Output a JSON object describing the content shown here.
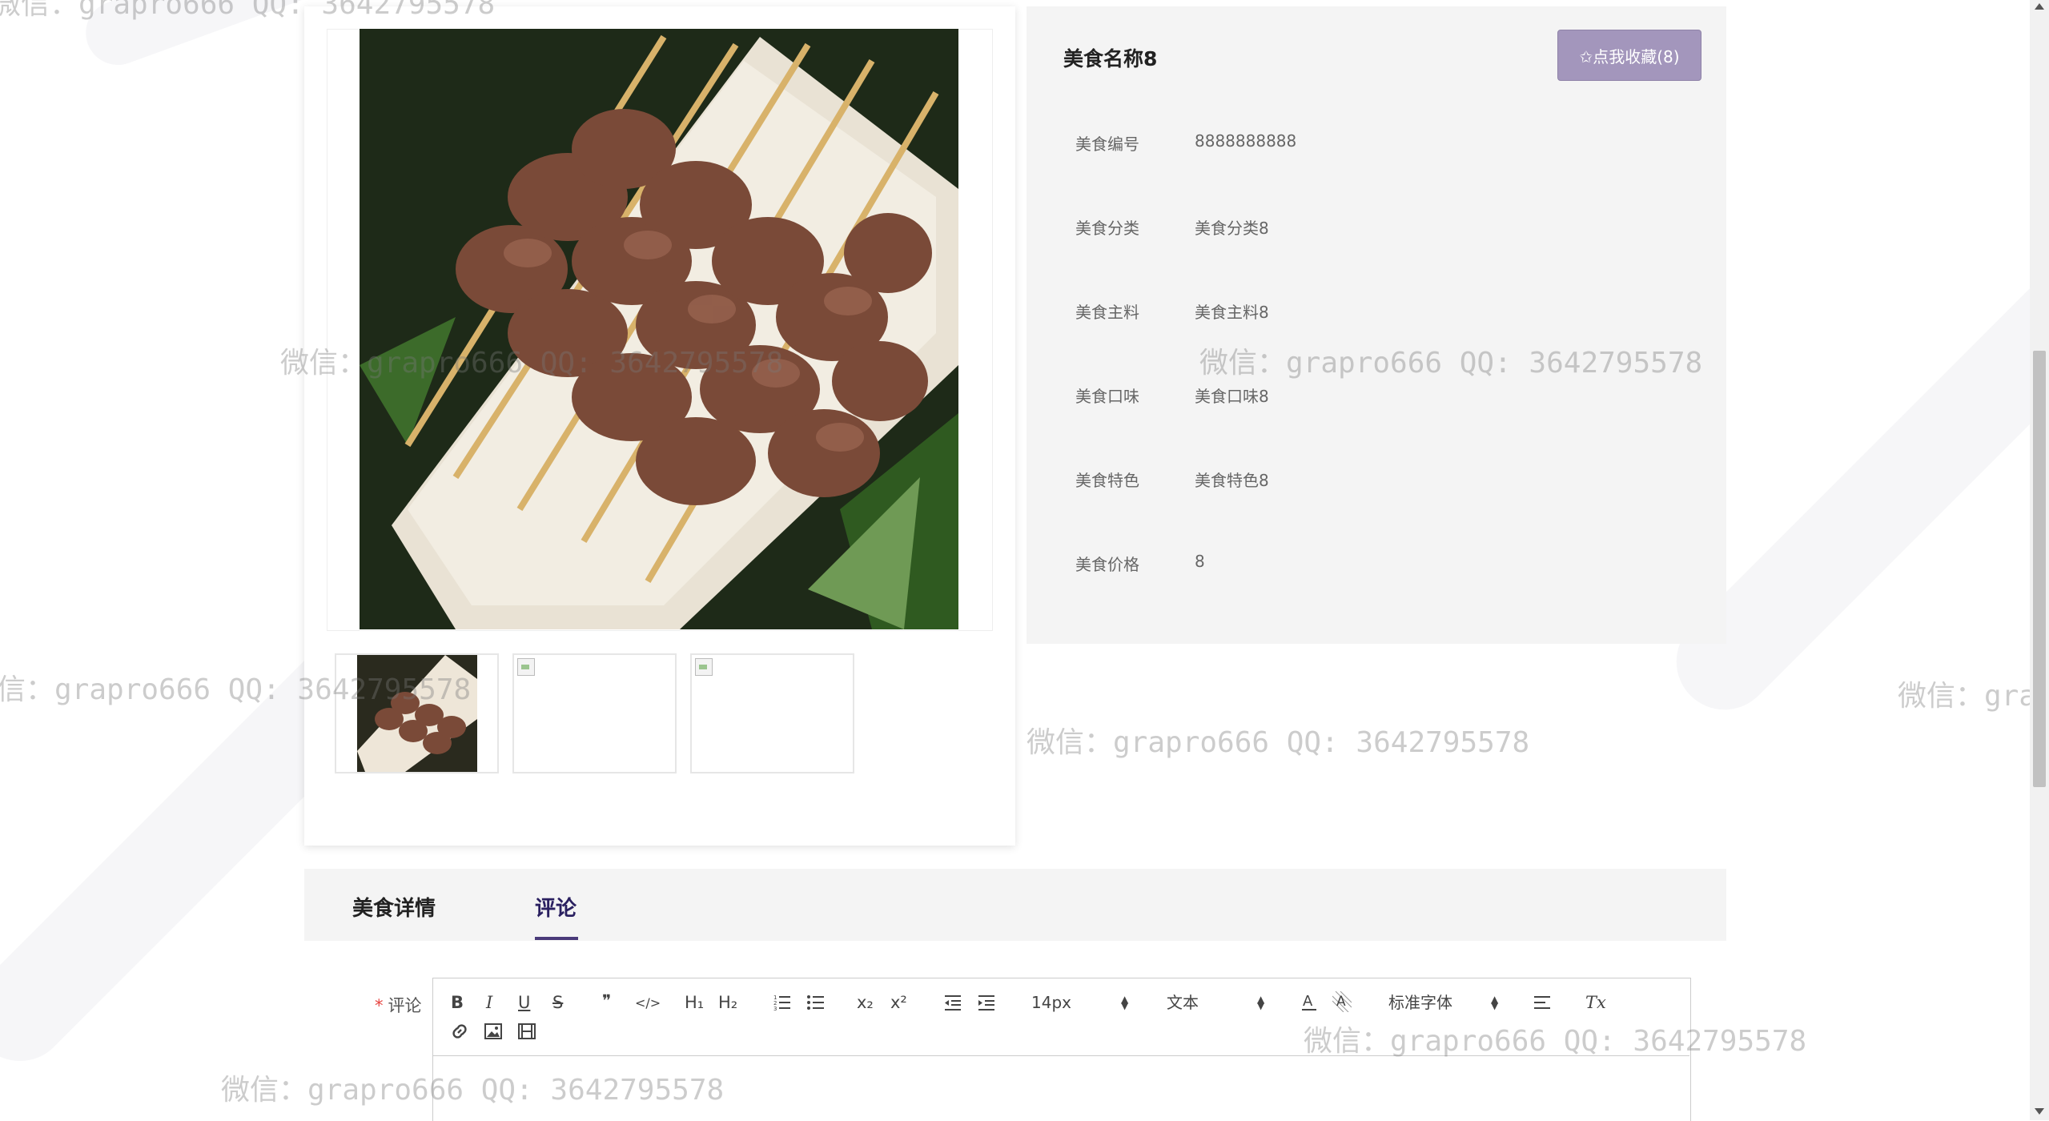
{
  "product": {
    "name": "美食名称8",
    "favorite_label": "✩点我收藏(8)",
    "fields": [
      {
        "label": "美食编号",
        "value": "8888888888"
      },
      {
        "label": "美食分类",
        "value": "美食分类8"
      },
      {
        "label": "美食主料",
        "value": "美食主料8"
      },
      {
        "label": "美食口味",
        "value": "美食口味8"
      },
      {
        "label": "美食特色",
        "value": "美食特色8"
      },
      {
        "label": "美食价格",
        "value": "8"
      }
    ]
  },
  "tabs": [
    {
      "label": "美食详情",
      "active": false
    },
    {
      "label": "评论",
      "active": true
    }
  ],
  "comment_form": {
    "required_mark": "*",
    "label": "评论",
    "toolbar": {
      "bold": "B",
      "italic": "I",
      "underline": "U",
      "strike": "S",
      "quote": "❞",
      "code": "</>",
      "h1": "H₁",
      "h2": "H₂",
      "subscript": "x₂",
      "superscript": "x²",
      "font_size": "14px",
      "text_type": "文本",
      "font_family": "标准字体",
      "clear": "Tx"
    }
  },
  "watermark_text": "微信：grapro666 QQ: 3642795578",
  "colors": {
    "favorite_button": "#a396bc",
    "active_tab": "#2a2060",
    "tab_underline": "#4a3a7a",
    "required": "#e64340"
  }
}
